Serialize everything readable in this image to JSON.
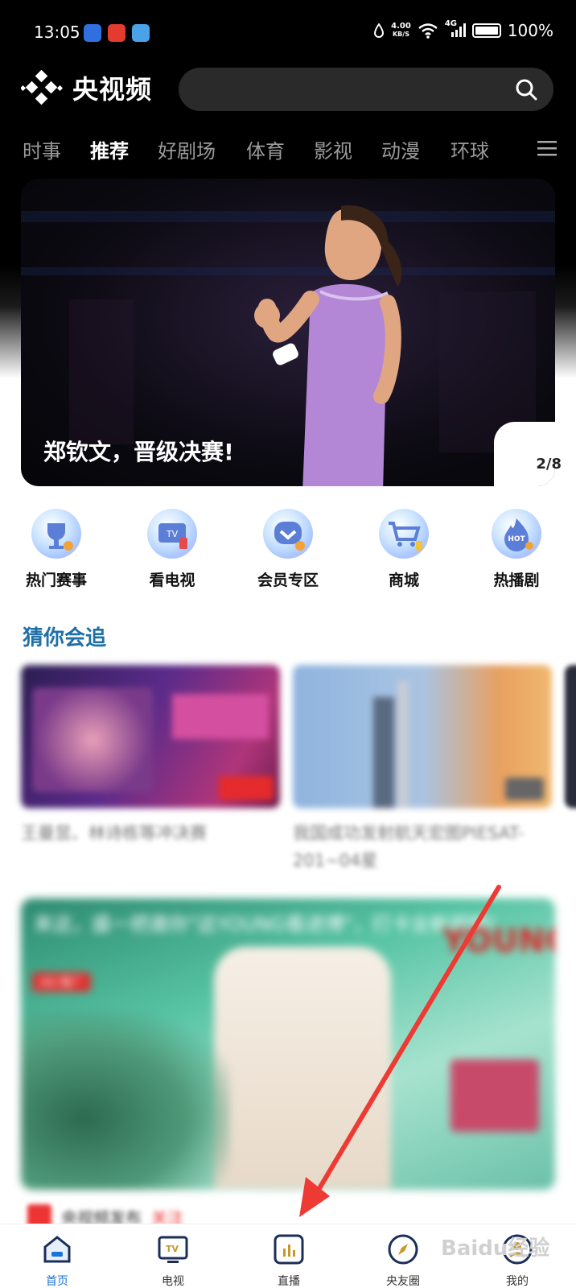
{
  "status_bar": {
    "time": "13:05",
    "net_speed_value": "4.00",
    "net_speed_unit": "KB/S",
    "network": "4G",
    "battery": "100%"
  },
  "app": {
    "logo_text": "央视频",
    "search_placeholder": ""
  },
  "tabs": [
    "时事",
    "推荐",
    "好剧场",
    "体育",
    "影视",
    "动漫",
    "环球"
  ],
  "active_tab": "推荐",
  "banner": {
    "caption": "郑钦文，晋级决赛!",
    "page": "2/8"
  },
  "quick_entries": [
    {
      "label": "热门赛事",
      "icon": "trophy-icon"
    },
    {
      "label": "看电视",
      "icon": "tv-icon"
    },
    {
      "label": "会员专区",
      "icon": "vip-icon"
    },
    {
      "label": "商城",
      "icon": "cart-icon"
    },
    {
      "label": "热播剧",
      "icon": "hot-flame-icon"
    }
  ],
  "section": {
    "title": "猜你会追"
  },
  "cards": [
    {
      "title": "王曼昱、林诗栋等冲决赛"
    },
    {
      "title": "我国成功发射航天宏图PIESAT-201~04星"
    }
  ],
  "ad": {
    "text": "来这，盛一把邀你\"这YOUNG看进博\"，打卡全新视频!",
    "tag": "AD 推广"
  },
  "feed_item": {
    "source": "央视频发布",
    "follow": "关注"
  },
  "bottom_nav": [
    {
      "label": "首页",
      "icon": "home-icon"
    },
    {
      "label": "电视",
      "icon": "tv-nav-icon"
    },
    {
      "label": "直播",
      "icon": "live-icon"
    },
    {
      "label": "央友圈",
      "icon": "compass-icon"
    },
    {
      "label": "我的",
      "icon": "profile-icon"
    }
  ],
  "colors": {
    "active_tab": "#ffffff",
    "section_title": "#1f6fa8",
    "nav_active": "#1a73d9",
    "annotation_arrow": "#ee3a34"
  },
  "watermark": "Baidu经验"
}
